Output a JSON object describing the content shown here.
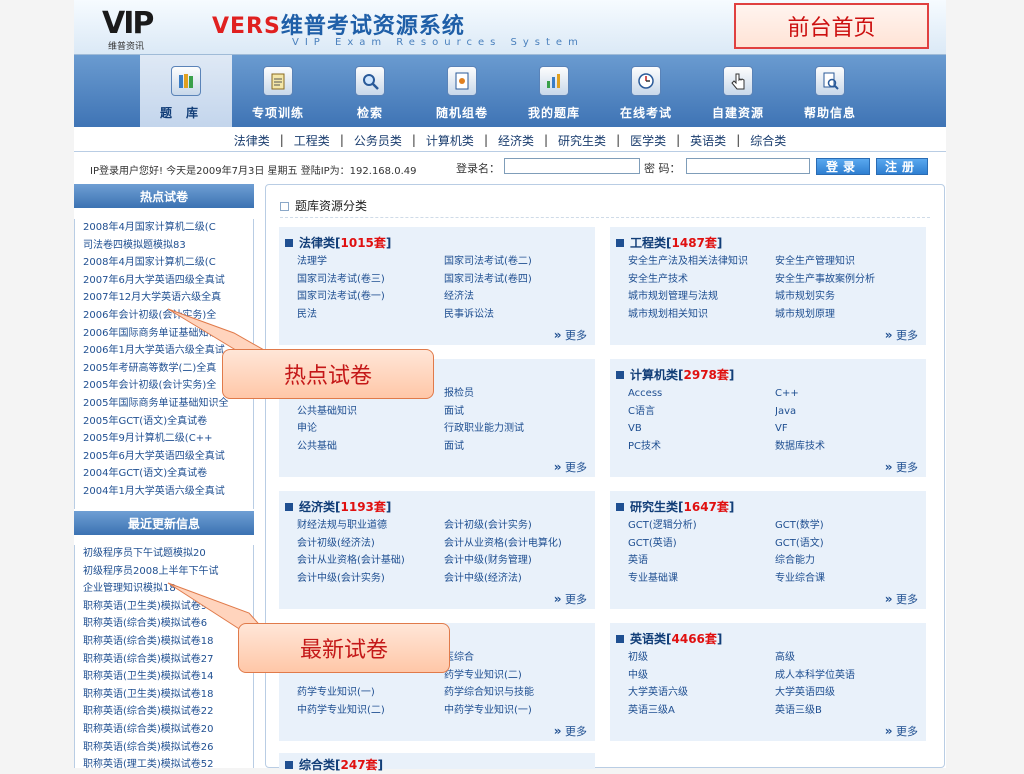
{
  "header": {
    "logo_text": "VIP",
    "logo_sub": "维普资讯",
    "title_prefix": "VERS",
    "title_main": "维普考试资源系统",
    "title_en": "VIP Exam Resources System",
    "home_label": "前台首页"
  },
  "nav": [
    {
      "label": "题库",
      "icon": "books-icon"
    },
    {
      "label": "专项训练",
      "icon": "clipboard-icon"
    },
    {
      "label": "检索",
      "icon": "magnifier-icon"
    },
    {
      "label": "随机组卷",
      "icon": "document-icon"
    },
    {
      "label": "我的题库",
      "icon": "chart-icon"
    },
    {
      "label": "在线考试",
      "icon": "clock-icon"
    },
    {
      "label": "自建资源",
      "icon": "hand-pointer-icon"
    },
    {
      "label": "帮助信息",
      "icon": "help-search-icon"
    }
  ],
  "categories": [
    "法律类",
    "工程类",
    "公务员类",
    "计算机类",
    "经济类",
    "研究生类",
    "医学类",
    "英语类",
    "综合类"
  ],
  "login": {
    "message": "IP登录用户您好! 今天是2009年7月3日 星期五 登陆IP为：192.168.0.49",
    "username_label": "登录名：",
    "password_label": "密 码：",
    "login_btn": "登录",
    "register_btn": "注册"
  },
  "hot": {
    "title": "热点试卷",
    "items": [
      "2008年4月国家计算机二级(C",
      "司法卷四模拟题模拟83",
      "2008年4月国家计算机二级(C",
      "2007年6月大学英语四级全真试",
      "2007年12月大学英语六级全真",
      "2006年会计初级(会计实务)全",
      "2006年国际商务单证基础知识",
      "2006年1月大学英语六级全真试",
      "2005年考研高等数学(二)全真",
      "2005年会计初级(会计实务)全",
      "2005年国际商务单证基础知识全",
      "2005年GCT(语文)全真试卷",
      "2005年9月计算机二级(C++",
      "2005年6月大学英语四级全真试",
      "2004年GCT(语文)全真试卷",
      "2004年1月大学英语六级全真试"
    ]
  },
  "latest": {
    "title": "最近更新信息",
    "items": [
      "初级程序员下午试题模拟20",
      "初级程序员2008上半年下午试",
      "企业管理知识模拟18",
      "职称英语(卫生类)模拟试卷9",
      "职称英语(综合类)模拟试卷6",
      "职称英语(综合类)模拟试卷18",
      "职称英语(综合类)模拟试卷27",
      "职称英语(卫生类)模拟试卷14",
      "职称英语(卫生类)模拟试卷18",
      "职称英语(综合类)模拟试卷22",
      "职称英语(综合类)模拟试卷20",
      "职称英语(综合类)模拟试卷26",
      "职称英语(理工类)模拟试卷52"
    ]
  },
  "main": {
    "title": "题库资源分类",
    "more_label": "更多",
    "boxes": [
      {
        "name": "法律类",
        "count": "1015套",
        "items": [
          "法理学",
          "国家司法考试(卷二)",
          "国家司法考试(卷三)",
          "国家司法考试(卷四)",
          "国家司法考试(卷一)",
          "经济法",
          "民法",
          "民事诉讼法"
        ]
      },
      {
        "name": "工程类",
        "count": "1487套",
        "items": [
          "安全生产法及相关法律知识",
          "安全生产管理知识",
          "安全生产技术",
          "安全生产事故案例分析",
          "城市规划管理与法规",
          "城市规划实务",
          "城市规划相关知识",
          "城市规划原理"
        ]
      },
      {
        "name": "",
        "count": "",
        "items": [
          "",
          "报检员",
          "公共基础知识",
          "面试",
          "申论",
          "行政职业能力测试",
          "公共基础",
          "面试"
        ]
      },
      {
        "name": "计算机类",
        "count": "2978套",
        "items": [
          "Access",
          "C++",
          "C语言",
          "Java",
          "VB",
          "VF",
          "PC技术",
          "数据库技术"
        ]
      },
      {
        "name": "经济类",
        "count": "1193套",
        "items": [
          "财经法规与职业道德",
          "会计初级(会计实务)",
          "会计初级(经济法)",
          "会计从业资格(会计电算化)",
          "会计从业资格(会计基础)",
          "会计中级(财务管理)",
          "会计中级(会计实务)",
          "会计中级(经济法)"
        ]
      },
      {
        "name": "研究生类",
        "count": "1647套",
        "items": [
          "GCT(逻辑分析)",
          "GCT(数学)",
          "GCT(英语)",
          "GCT(语文)",
          "英语",
          "综合能力",
          "专业基础课",
          "专业综合课"
        ]
      },
      {
        "name": "",
        "count": "",
        "items": [
          "",
          "医综合",
          "",
          "药学专业知识(二)",
          "药学专业知识(一)",
          "药学综合知识与技能",
          "中药学专业知识(二)",
          "中药学专业知识(一)"
        ]
      },
      {
        "name": "英语类",
        "count": "4466套",
        "items": [
          "初级",
          "高级",
          "中级",
          "成人本科学位英语",
          "大学英语六级",
          "大学英语四级",
          "英语三级A",
          "英语三级B"
        ]
      }
    ],
    "bottom_box": {
      "name": "综合类",
      "count": "247套"
    }
  },
  "callouts": {
    "hot": "热点试卷",
    "latest": "最新试卷"
  },
  "colors": {
    "nav_blue": "#3f74b5",
    "accent_red": "#e01010",
    "link_blue": "#1f4f91"
  }
}
